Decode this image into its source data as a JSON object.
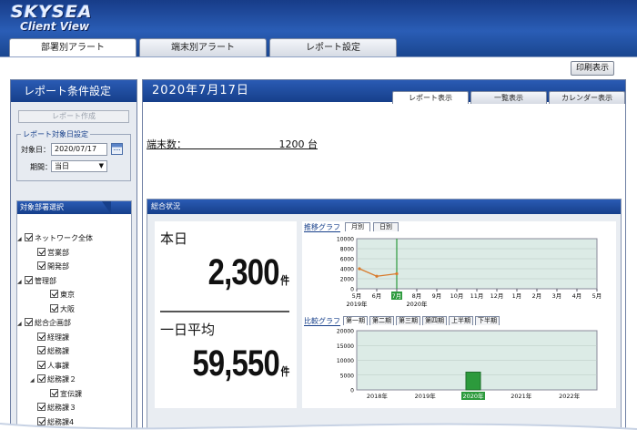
{
  "app": {
    "logo_line1": "SKYSEA",
    "logo_line2": "Client View"
  },
  "top_tabs": [
    {
      "label": "部署別アラート",
      "active": true
    },
    {
      "label": "端末別アラート",
      "active": false
    },
    {
      "label": "レポート設定",
      "active": false
    }
  ],
  "toolbar": {
    "print_label": "印刷表示"
  },
  "sidebar": {
    "title": "レポート条件設定",
    "create_button": "レポート作成",
    "date_group_title": "レポート対象日設定",
    "target_date_label": "対象日：",
    "target_date_value": "2020/07/17",
    "period_label": "期間：",
    "period_value": "当日",
    "dept_header": "対象部署選択",
    "tree": [
      {
        "label": "ネットワーク全体",
        "level": 0,
        "expandable": true
      },
      {
        "label": "営業部",
        "level": 1,
        "expandable": false
      },
      {
        "label": "開発部",
        "level": 1,
        "expandable": false
      },
      {
        "label": "管理部",
        "level": 0,
        "expandable": true
      },
      {
        "label": "東京",
        "level": 2,
        "expandable": false
      },
      {
        "label": "大阪",
        "level": 2,
        "expandable": false
      },
      {
        "label": "総合企画部",
        "level": 0,
        "expandable": true
      },
      {
        "label": "経理課",
        "level": 1,
        "expandable": false
      },
      {
        "label": "総務課",
        "level": 1,
        "expandable": false
      },
      {
        "label": "人事課",
        "level": 1,
        "expandable": false
      },
      {
        "label": "総務課２",
        "level": 1,
        "expandable": true
      },
      {
        "label": "宣伝課",
        "level": 2,
        "expandable": false
      },
      {
        "label": "総務課３",
        "level": 1,
        "expandable": false
      },
      {
        "label": "総務課4",
        "level": 1,
        "expandable": false
      }
    ]
  },
  "content": {
    "date_title": "2020年7月17日",
    "view_tabs": [
      {
        "label": "レポート表示",
        "active": true
      },
      {
        "label": "一覧表示",
        "active": false
      },
      {
        "label": "カレンダー表示",
        "active": false
      }
    ],
    "terminal_label": "端末数：",
    "terminal_value": "1200 台",
    "summary_header": "総合状況",
    "today_label": "本日",
    "today_value": "2,300",
    "today_unit": "件",
    "avg_label": "一日平均",
    "avg_value": "59,550",
    "avg_unit": "件",
    "trend_graph_title": "推移グラフ",
    "trend_tabs": [
      "月別",
      "日別"
    ],
    "compare_graph_title": "比較グラフ",
    "compare_tabs": [
      "第一期",
      "第二期",
      "第三期",
      "第四期",
      "上半期",
      "下半期"
    ]
  },
  "colors": {
    "header_blue": "#1a468f",
    "line_series": "#d87a2c",
    "bar_series": "#2c9a3c",
    "plot_bg": "#dcebe6",
    "highlight_green": "#2c9a3c"
  },
  "chart_data": [
    {
      "type": "line",
      "title": "推移グラフ",
      "x": [
        "5月",
        "6月",
        "7月",
        "8月",
        "9月",
        "10月",
        "11月",
        "12月",
        "1月",
        "2月",
        "3月",
        "4月",
        "5月"
      ],
      "year_labels": [
        "2019年",
        "2020年"
      ],
      "highlight": "7月",
      "series": [
        {
          "values": [
            4000,
            2500,
            3000
          ]
        }
      ],
      "ylim": [
        0,
        10000
      ],
      "yticks": [
        "10000",
        "8000",
        "6000",
        "4000",
        "2000",
        "0"
      ]
    },
    {
      "type": "bar",
      "title": "比較グラフ",
      "categories": [
        "2018年",
        "2019年",
        "2020年",
        "2021年",
        "2022年"
      ],
      "highlight": "2020年",
      "values": [
        0,
        0,
        6000,
        0,
        0
      ],
      "ylim": [
        0,
        20000
      ],
      "yticks": [
        "20000",
        "15000",
        "10000",
        "5000",
        "0"
      ]
    }
  ]
}
